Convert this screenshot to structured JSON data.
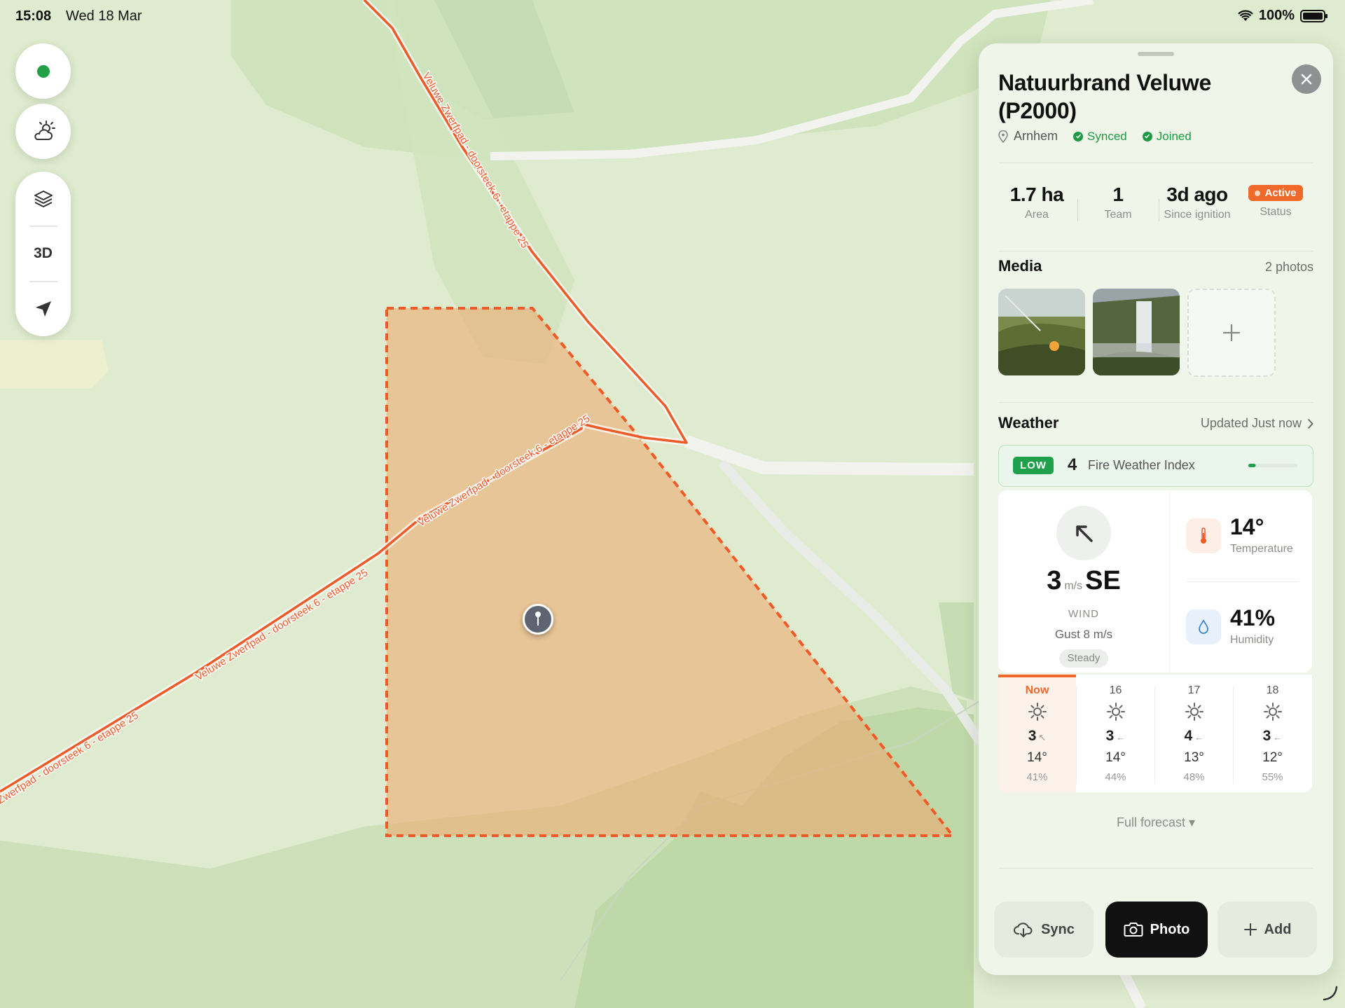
{
  "status_bar": {
    "time": "15:08",
    "date": "Wed 18 Mar",
    "battery": "100%"
  },
  "map": {
    "trail_label": "Veluwe Zwerfpad - doorsteek 6 - etappe 25",
    "trail_label_partial": "Zwerfpad - doorsteek 6 - etappe 25",
    "route_color": "#ef5a28",
    "fire_area_color": "#f0a56a"
  },
  "map_controls": {
    "layers_icon": "layers-icon",
    "three_d_label": "3D",
    "locate_icon": "location-arrow-icon",
    "weather_icon": "cloud-sun-icon"
  },
  "panel": {
    "title": "Natuurbrand Veluwe (P2000)",
    "location": "Arnhem",
    "synced": "Synced",
    "joined": "Joined",
    "stats": [
      {
        "value": "1.7 ha",
        "label": "Area"
      },
      {
        "value": "1",
        "label": "Team"
      },
      {
        "value": "3d ago",
        "label": "Since ignition"
      }
    ],
    "status": {
      "badge": "Active",
      "label": "Status"
    },
    "media": {
      "title": "Media",
      "count": "2 photos"
    },
    "weather": {
      "title": "Weather",
      "updated": "Updated Just now",
      "fwi_level": "LOW",
      "fwi_value": "4",
      "fwi_label": "Fire Weather Index",
      "fwi_fraction": 0.15,
      "wind_speed": "3",
      "wind_unit": "m/s",
      "wind_dir": "SE",
      "wind_label": "WIND",
      "gust": "Gust 8 m/s",
      "steady": "Steady",
      "temperature": "14°",
      "temperature_label": "Temperature",
      "humidity": "41%",
      "humidity_label": "Humidity"
    },
    "forecast": [
      {
        "hour": "Now",
        "wind": "3",
        "temp": "14°",
        "hum": "41%"
      },
      {
        "hour": "16",
        "wind": "3",
        "temp": "14°",
        "hum": "44%"
      },
      {
        "hour": "17",
        "wind": "4",
        "temp": "13°",
        "hum": "48%"
      },
      {
        "hour": "18",
        "wind": "3",
        "temp": "12°",
        "hum": "55%"
      }
    ],
    "full_forecast": "Full forecast ▾",
    "buttons": {
      "sync": "Sync",
      "photo": "Photo",
      "add": "Add"
    }
  }
}
